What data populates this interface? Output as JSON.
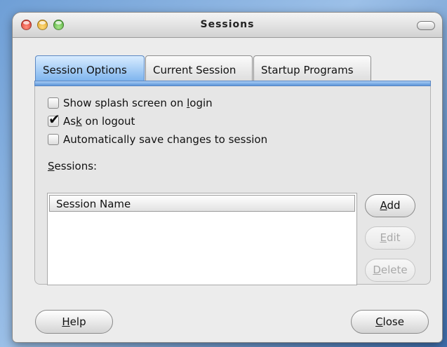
{
  "window": {
    "title": "Sessions"
  },
  "tabs": [
    {
      "label": "Session Options",
      "active": true
    },
    {
      "label": "Current Session",
      "active": false
    },
    {
      "label": "Startup Programs",
      "active": false
    }
  ],
  "options": [
    {
      "pre": "Show splash screen on ",
      "mnemonic": "l",
      "post": "ogin",
      "checked": false
    },
    {
      "pre": "As",
      "mnemonic": "k",
      "post": " on logout",
      "checked": true
    },
    {
      "pre": "",
      "mnemonic": "",
      "post": "Automatically save changes to session",
      "checked": false
    }
  ],
  "sessions_section": {
    "label_mnemonic": "S",
    "label_rest": "essions:",
    "column_header": "Session Name",
    "rows": []
  },
  "side_buttons": {
    "add": {
      "mnemonic": "A",
      "rest": "dd",
      "enabled": true
    },
    "edit": {
      "mnemonic": "E",
      "rest": "dit",
      "enabled": false
    },
    "delete": {
      "mnemonic": "D",
      "rest": "elete",
      "enabled": false
    }
  },
  "bottom_buttons": {
    "help": {
      "mnemonic": "H",
      "rest": "elp"
    },
    "close": {
      "mnemonic": "C",
      "rest": "lose"
    }
  }
}
